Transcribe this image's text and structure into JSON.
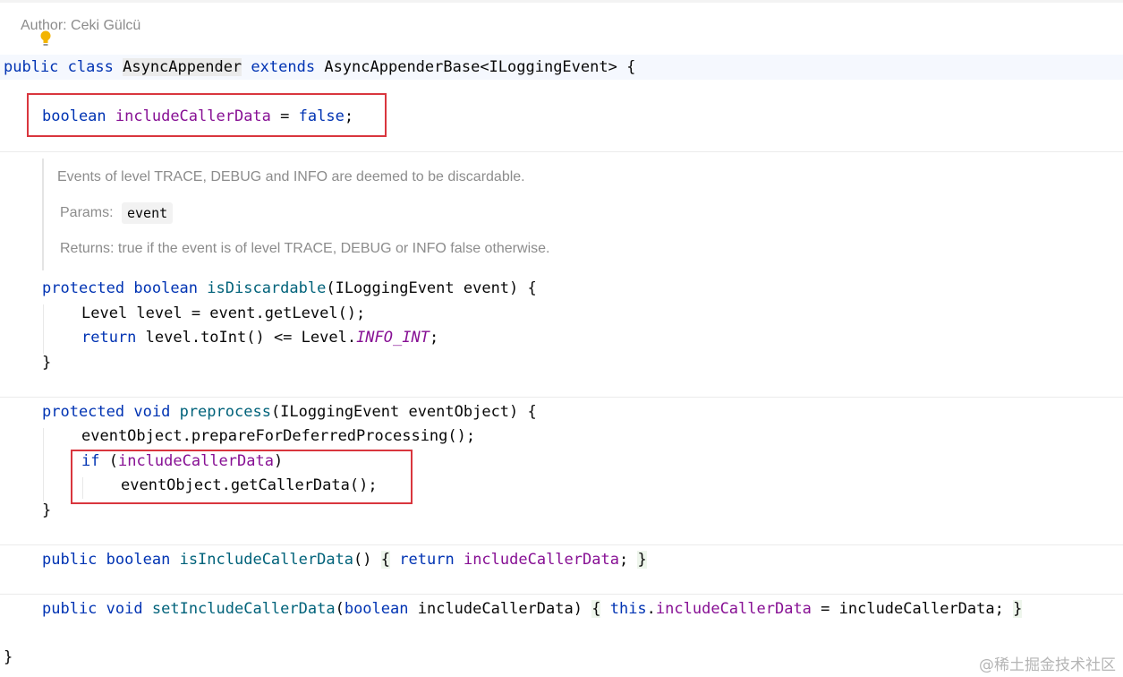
{
  "header": {
    "author": "Author: Ceki Gülcü"
  },
  "class_decl": {
    "kw_public": "public",
    "kw_class": "class",
    "name": "AsyncAppender",
    "kw_extends": "extends",
    "base": "AsyncAppenderBase<ILoggingEvent> {"
  },
  "field_line": {
    "kw_boolean": "boolean",
    "name": "includeCallerData",
    "eq": " = ",
    "val": "false",
    "semi": ";"
  },
  "javadoc": {
    "desc": "Events of level TRACE, DEBUG and INFO are deemed to be discardable.",
    "params_label": "Params:",
    "params_value": "event",
    "returns": "Returns: true if the event is of level TRACE, DEBUG or INFO false otherwise."
  },
  "method1": {
    "kw_protected": "protected",
    "kw_boolean": "boolean",
    "name": "isDiscardable",
    "sig_rest": "(ILoggingEvent event) {",
    "line2": "Level level = event.getLevel();",
    "kw_return": "return",
    "line3_mid": " level.toInt() <= Level.",
    "const": "INFO_INT",
    "line3_end": ";",
    "close": "}"
  },
  "method2": {
    "kw_protected": "protected",
    "kw_void": "void",
    "name": "preprocess",
    "sig_rest": "(ILoggingEvent eventObject) {",
    "line2": "eventObject.prepareForDeferredProcessing();",
    "kw_if": "if",
    "if_open": " (",
    "if_field": "includeCallerData",
    "if_close": ")",
    "line4": "eventObject.getCallerData();",
    "close": "}"
  },
  "method3": {
    "kw_public": "public",
    "kw_boolean": "boolean",
    "name": "isIncludeCallerData",
    "parens": "()",
    "brace_open": "{",
    "kw_return": "return",
    "field": "includeCallerData",
    "semi": ";",
    "brace_close": "}"
  },
  "method4": {
    "kw_public": "public",
    "kw_void": "void",
    "name": "setIncludeCallerData",
    "paren_open": "(",
    "kw_boolean": "boolean",
    "param_rest": "includeCallerData)",
    "brace_open": "{",
    "kw_this": "this",
    "dot": ".",
    "field": "includeCallerData",
    "assign_rest": " = includeCallerData;",
    "brace_close": "}"
  },
  "class_close": "}",
  "watermark": "@稀土掘金技术社区"
}
